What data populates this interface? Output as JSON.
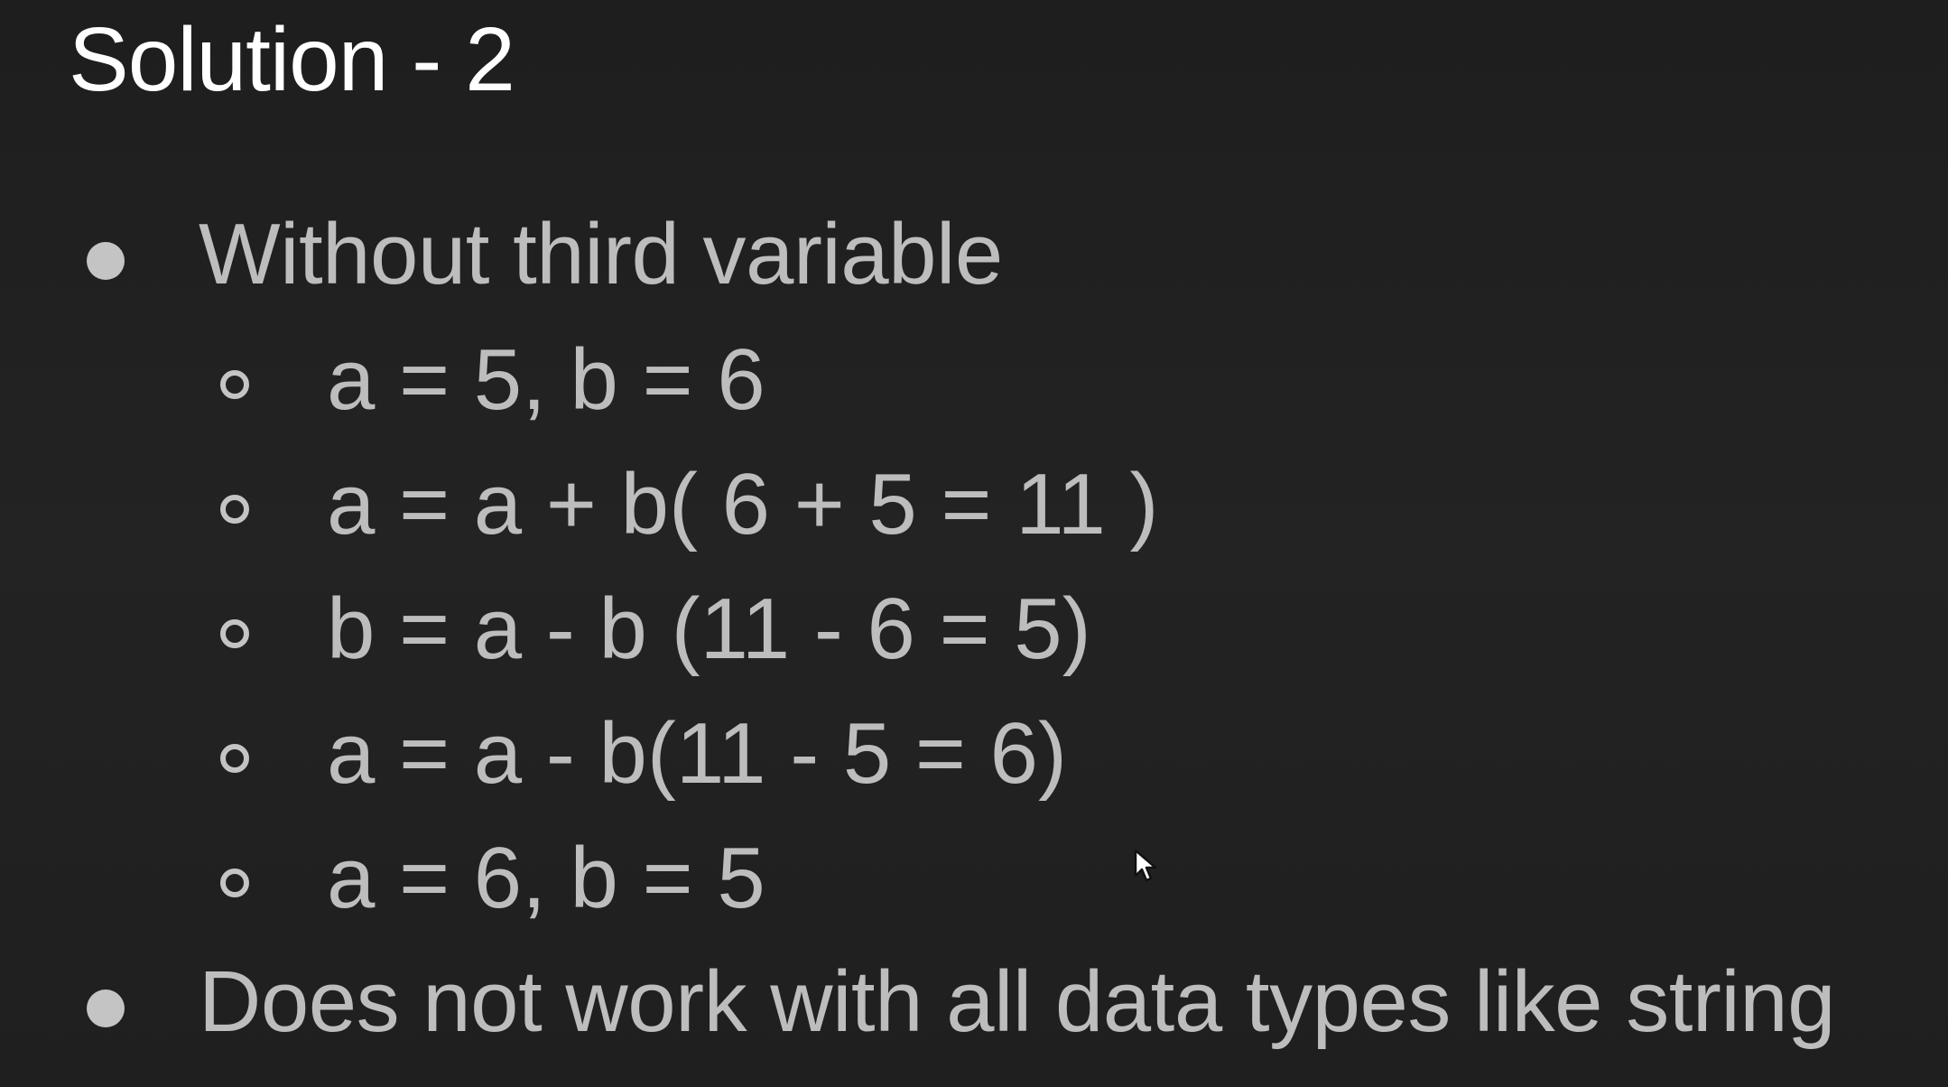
{
  "slide": {
    "title": "Solution - 2",
    "items": [
      {
        "text": "Without third variable",
        "subitems": [
          "a = 5, b = 6",
          "a = a + b( 6 + 5 = 11 )",
          "b = a - b (11 - 6 = 5)",
          "a = a - b(11 - 5 = 6)",
          "a = 6, b = 5"
        ]
      },
      {
        "text": "Does not work with all data types like string"
      }
    ]
  },
  "colors": {
    "background": "#222222",
    "title": "#ffffff",
    "body_text": "#bdbdbd",
    "bullet": "#c4c4c4"
  },
  "icons": {
    "cursor": "mouse-pointer-icon"
  }
}
